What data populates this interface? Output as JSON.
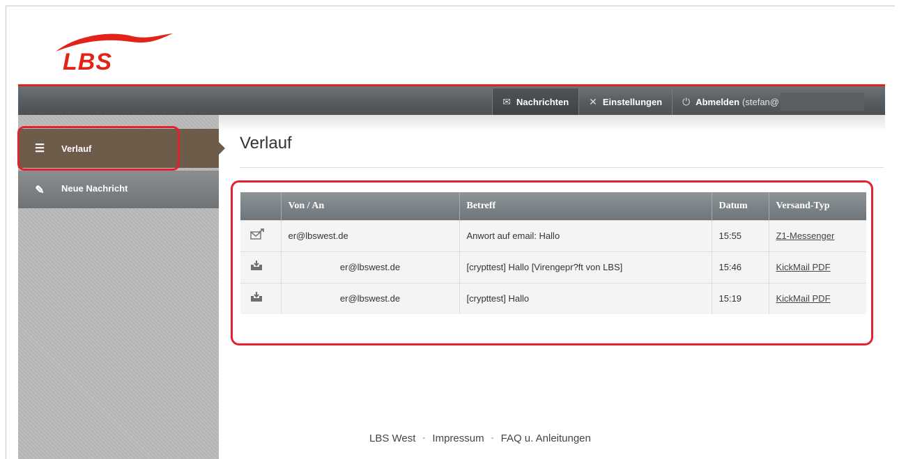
{
  "brand": {
    "logo_text": "LBS",
    "brand_color": "#e2231a"
  },
  "topnav": {
    "items": [
      {
        "icon": "envelope-icon",
        "label": "Nachrichten"
      },
      {
        "icon": "tools-icon",
        "label": "Einstellungen"
      },
      {
        "icon": "power-icon",
        "label": "Abmelden",
        "extra": "(stefan@"
      }
    ]
  },
  "sidebar": {
    "items": [
      {
        "icon": "list-icon",
        "label": "Verlauf"
      },
      {
        "icon": "compose-icon",
        "label": "Neue Nachricht"
      }
    ]
  },
  "main": {
    "title": "Verlauf",
    "table": {
      "columns": [
        "",
        "Von / An",
        "Betreff",
        "Datum",
        "Versand-Typ"
      ],
      "rows": [
        {
          "icon": "outgoing-mail-icon",
          "from_to": "er@lbswest.de",
          "subject": "Anwort auf email: Hallo",
          "date": "15:55",
          "type": "Z1-Messenger"
        },
        {
          "icon": "inbox-download-icon",
          "from_to": "er@lbswest.de",
          "subject": "[crypttest] Hallo [Virengepr?ft von LBS]",
          "date": "15:46",
          "type": "KickMail PDF"
        },
        {
          "icon": "inbox-download-icon",
          "from_to": "er@lbswest.de",
          "subject": "[crypttest] Hallo",
          "date": "15:19",
          "type": "KickMail PDF"
        }
      ]
    }
  },
  "footer": {
    "links": [
      "LBS West",
      "Impressum",
      "FAQ u. Anleitungen"
    ],
    "separator": "-"
  },
  "annotation_color": "#e3202b"
}
